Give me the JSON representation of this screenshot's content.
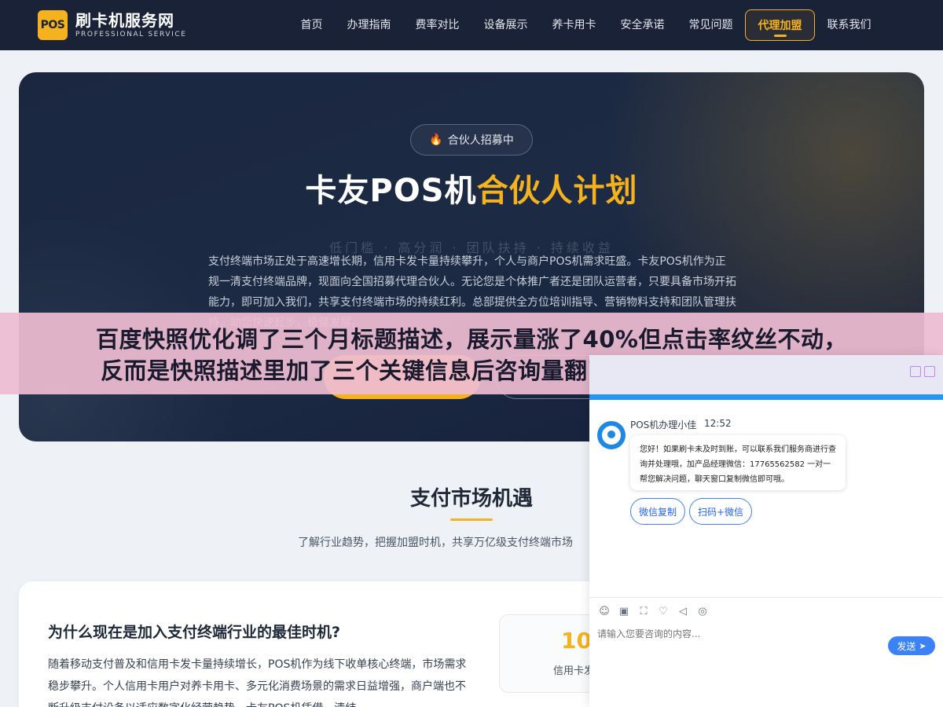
{
  "header": {
    "logo_badge": "POS",
    "logo_title": "刷卡机服务网",
    "logo_subtitle": "PROFESSIONAL SERVICE",
    "nav": [
      "首页",
      "办理指南",
      "费率对比",
      "设备展示",
      "养卡用卡",
      "安全承诺",
      "常见问题",
      "代理加盟",
      "联系我们"
    ],
    "active_nav": "代理加盟"
  },
  "hero": {
    "badge": "合伙人招募中",
    "title_part1": "卡友POS机",
    "title_part2": "合伙人计划",
    "faded_line": "低门槛 · 高分润 · 团队扶持 · 持续收益",
    "description": "支付终端市场正处于高速增长期，信用卡发卡量持续攀升，个人与商户POS机需求旺盛。卡友POS机作为正规一清支付终端品牌，现面向全国招募代理合伙人。无论您是个体推广者还是团队运营者，只要具备市场开拓能力，即可加入我们，共享支付终端市场的持续红利。总部提供全方位培训指导、营销物料支持和团队管理扶持，助您快速起步，稳健发展。"
  },
  "market": {
    "title": "支付市场机遇",
    "subtitle": "了解行业趋势，把握加盟时机，共享万亿级支付终端市场",
    "card_title": "为什么现在是加入支付终端行业的最佳时机?",
    "card_text": "随着移动支付普及和信用卡发卡量持续增长，POS机作为线下收单核心终端，市场需求稳步攀升。个人信用卡用户对养卡用卡、多元化消费场景的需求日益增强，商户端也不断升级支付设备以适应数字化经营趋势，卡友POS机凭借，清结",
    "stat_number": "10",
    "stat_label": "信用卡发"
  },
  "overlay": {
    "line1": "百度快照优化调了三个月标题描述，展示量涨了40%但点击率纹丝不动，",
    "line2": "反而是快照描述里加了三个关键信息后咨询量翻了倍，快照优化的重心根"
  },
  "chat": {
    "agent_name": "POS机办理小佳",
    "time": "12:52",
    "message": "您好！如果刷卡未及时到账，可以联系我们服务商进行查询并处理哦，加产品经理微信：17765562582 一对一帮您解决问题，聊天窗口复制微信即可哦。",
    "quick_buttons": [
      "微信复制",
      "扫码+微信"
    ],
    "input_placeholder": "请输入您要咨询的内容...",
    "send_label": "发送"
  },
  "colors": {
    "navy": "#1a2238",
    "gold": "#f5b21f",
    "chat_blue": "#2196f3"
  }
}
